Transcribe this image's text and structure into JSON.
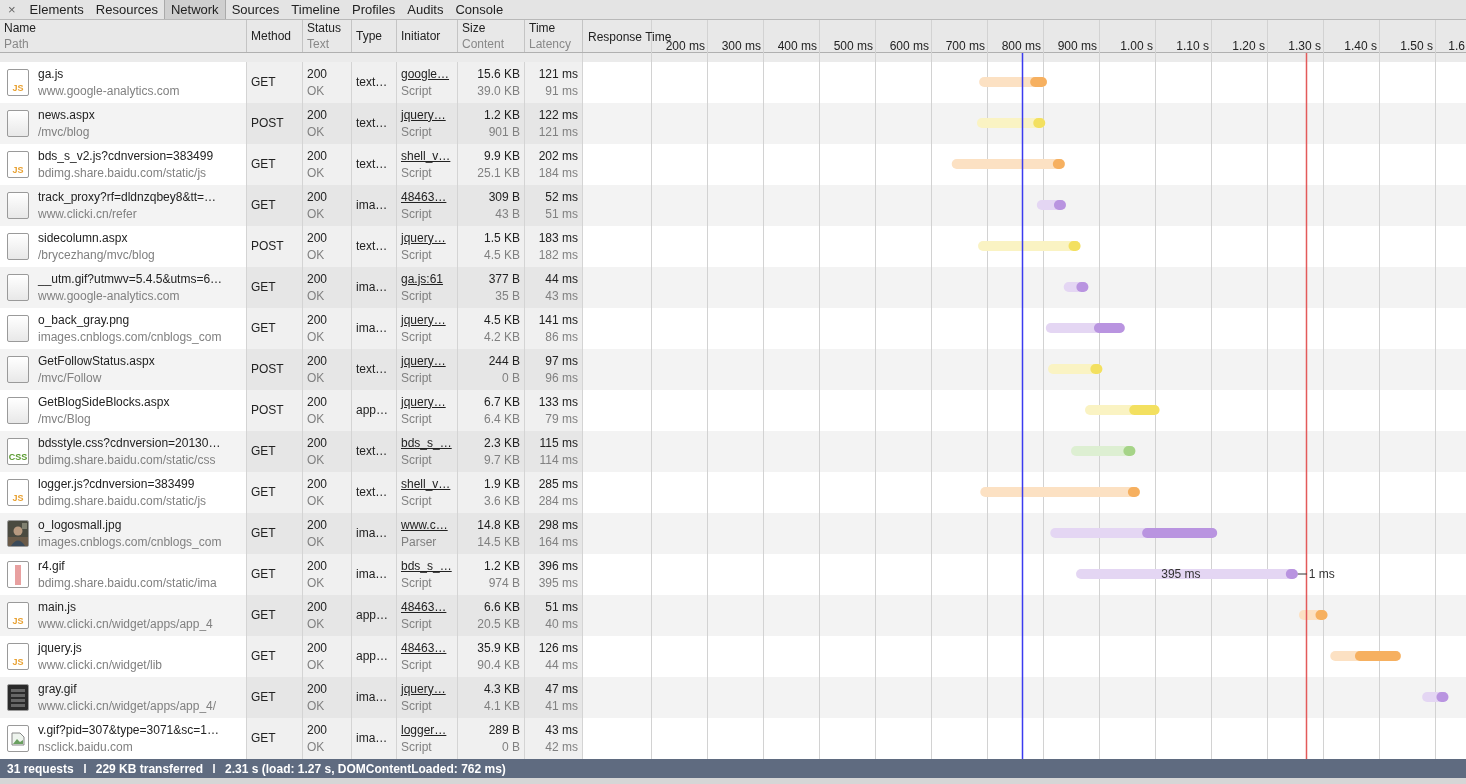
{
  "close_button": "×",
  "tabs": [
    {
      "label": "Elements",
      "selected": false
    },
    {
      "label": "Resources",
      "selected": false
    },
    {
      "label": "Network",
      "selected": true
    },
    {
      "label": "Sources",
      "selected": false
    },
    {
      "label": "Timeline",
      "selected": false
    },
    {
      "label": "Profiles",
      "selected": false
    },
    {
      "label": "Audits",
      "selected": false
    },
    {
      "label": "Console",
      "selected": false
    }
  ],
  "columns": [
    {
      "title": "Name",
      "subtitle": "Path"
    },
    {
      "title": "Method"
    },
    {
      "title": "Status",
      "subtitle": "Text"
    },
    {
      "title": "Type"
    },
    {
      "title": "Initiator"
    },
    {
      "title": "Size",
      "subtitle": "Content"
    },
    {
      "title": "Time",
      "subtitle": "Latency"
    }
  ],
  "timeline_header": "Response Time",
  "requests": [
    {
      "name": "ga.js",
      "path": "www.google-analytics.com",
      "kind": "script",
      "icon_text": "JS",
      "method": "GET",
      "status": "200",
      "status_text": "OK",
      "type": "text…",
      "initiator": "google…",
      "initiator_type": "Script",
      "size": "15.6 KB",
      "content": "39.0 KB",
      "time": "121 ms",
      "latency": "91 ms",
      "color": "#f6b060"
    },
    {
      "name": "news.aspx",
      "path": "/mvc/blog",
      "kind": "blank",
      "method": "POST",
      "status": "200",
      "status_text": "OK",
      "type": "text…",
      "initiator": "jquery…",
      "initiator_type": "Script",
      "size": "1.2 KB",
      "content": "901 B",
      "time": "122 ms",
      "latency": "121 ms",
      "color": "#f3e060"
    },
    {
      "name": "bds_s_v2.js?cdnversion=383499",
      "path": "bdimg.share.baidu.com/static/js",
      "kind": "script",
      "icon_text": "JS",
      "method": "GET",
      "status": "200",
      "status_text": "OK",
      "type": "text…",
      "initiator": "shell_v…",
      "initiator_type": "Script",
      "size": "9.9 KB",
      "content": "25.1 KB",
      "time": "202 ms",
      "latency": "184 ms",
      "color": "#f6b060"
    },
    {
      "name": "track_proxy?rf=dldnzqbey8&tt=…",
      "path": "www.clicki.cn/refer",
      "kind": "blank",
      "method": "GET",
      "status": "200",
      "status_text": "OK",
      "type": "ima…",
      "initiator": "48463…",
      "initiator_type": "Script",
      "size": "309 B",
      "content": "43 B",
      "time": "52 ms",
      "latency": "51 ms",
      "color": "#b994e0"
    },
    {
      "name": "sidecolumn.aspx",
      "path": "/brycezhang/mvc/blog",
      "kind": "blank",
      "method": "POST",
      "status": "200",
      "status_text": "OK",
      "type": "text…",
      "initiator": "jquery…",
      "initiator_type": "Script",
      "size": "1.5 KB",
      "content": "4.5 KB",
      "time": "183 ms",
      "latency": "182 ms",
      "color": "#f3e060"
    },
    {
      "name": "__utm.gif?utmwv=5.4.5&utms=6…",
      "path": "www.google-analytics.com",
      "kind": "blank",
      "method": "GET",
      "status": "200",
      "status_text": "OK",
      "type": "ima…",
      "initiator": "ga.js:61",
      "initiator_type": "Script",
      "size": "377 B",
      "content": "35 B",
      "time": "44 ms",
      "latency": "43 ms",
      "color": "#b994e0"
    },
    {
      "name": "o_back_gray.png",
      "path": "images.cnblogs.com/cnblogs_com",
      "kind": "blank",
      "method": "GET",
      "status": "200",
      "status_text": "OK",
      "type": "ima…",
      "initiator": "jquery…",
      "initiator_type": "Script",
      "size": "4.5 KB",
      "content": "4.2 KB",
      "time": "141 ms",
      "latency": "86 ms",
      "color": "#b994e0"
    },
    {
      "name": "GetFollowStatus.aspx",
      "path": "/mvc/Follow",
      "kind": "blank",
      "method": "POST",
      "status": "200",
      "status_text": "OK",
      "type": "text…",
      "initiator": "jquery…",
      "initiator_type": "Script",
      "size": "244 B",
      "content": "0 B",
      "time": "97 ms",
      "latency": "96 ms",
      "color": "#f3e060"
    },
    {
      "name": "GetBlogSideBlocks.aspx",
      "path": "/mvc/Blog",
      "kind": "blank",
      "method": "POST",
      "status": "200",
      "status_text": "OK",
      "type": "app…",
      "initiator": "jquery…",
      "initiator_type": "Script",
      "size": "6.7 KB",
      "content": "6.4 KB",
      "time": "133 ms",
      "latency": "79 ms",
      "color": "#f3e060"
    },
    {
      "name": "bdsstyle.css?cdnversion=20130…",
      "path": "bdimg.share.baidu.com/static/css",
      "kind": "stylesheet",
      "icon_text": "CSS",
      "method": "GET",
      "status": "200",
      "status_text": "OK",
      "type": "text…",
      "initiator": "bds_s_…",
      "initiator_type": "Script",
      "size": "2.3 KB",
      "content": "9.7 KB",
      "time": "115 ms",
      "latency": "114 ms",
      "color": "#a6d488"
    },
    {
      "name": "logger.js?cdnversion=383499",
      "path": "bdimg.share.baidu.com/static/js",
      "kind": "script",
      "icon_text": "JS",
      "method": "GET",
      "status": "200",
      "status_text": "OK",
      "type": "text…",
      "initiator": "shell_v…",
      "initiator_type": "Script",
      "size": "1.9 KB",
      "content": "3.6 KB",
      "time": "285 ms",
      "latency": "284 ms",
      "color": "#f6b060"
    },
    {
      "name": "o_logosmall.jpg",
      "path": "images.cnblogs.com/cnblogs_com",
      "method": "GET",
      "status": "200",
      "status_text": "OK",
      "type": "ima…",
      "initiator": "www.c…",
      "initiator_type": "Parser",
      "size": "14.8 KB",
      "content": "14.5 KB",
      "time": "298 ms",
      "latency": "164 ms",
      "color": "#b994e0"
    },
    {
      "name": "r4.gif",
      "path": "bdimg.share.baidu.com/static/ima",
      "kind": "strip",
      "method": "GET",
      "status": "200",
      "status_text": "OK",
      "type": "ima…",
      "initiator": "bds_s_…",
      "initiator_type": "Script",
      "size": "1.2 KB",
      "content": "974 B",
      "time": "396 ms",
      "latency": "395 ms",
      "color": "#b994e0"
    },
    {
      "name": "main.js",
      "path": "www.clicki.cn/widget/apps/app_4",
      "kind": "script",
      "icon_text": "JS",
      "method": "GET",
      "status": "200",
      "status_text": "OK",
      "type": "app…",
      "initiator": "48463…",
      "initiator_type": "Script",
      "size": "6.6 KB",
      "content": "20.5 KB",
      "time": "51 ms",
      "latency": "40 ms",
      "color": "#f6b060"
    },
    {
      "name": "jquery.js",
      "path": "www.clicki.cn/widget/lib",
      "kind": "script",
      "icon_text": "JS",
      "method": "GET",
      "status": "200",
      "status_text": "OK",
      "type": "app…",
      "initiator": "48463…",
      "initiator_type": "Script",
      "size": "35.9 KB",
      "content": "90.4 KB",
      "time": "126 ms",
      "latency": "44 ms",
      "color": "#f6b060"
    },
    {
      "name": "gray.gif",
      "path": "www.clicki.cn/widget/apps/app_4/",
      "kind": "dark",
      "method": "GET",
      "status": "200",
      "status_text": "OK",
      "type": "ima…",
      "initiator": "jquery…",
      "initiator_type": "Script",
      "size": "4.3 KB",
      "content": "4.1 KB",
      "time": "47 ms",
      "latency": "41 ms",
      "color": "#b994e0"
    },
    {
      "name": "v.gif?pid=307&type=3071&sc=1…",
      "path": "nsclick.baidu.com",
      "kind": "broken",
      "method": "GET",
      "status": "200",
      "status_text": "OK",
      "type": "ima…",
      "initiator": "logger…",
      "initiator_type": "Script",
      "size": "289 B",
      "content": "0 B",
      "time": "43 ms",
      "latency": "42 ms"
    }
  ],
  "timeline": {
    "tick_labels": [
      "200 ms",
      "300 ms",
      "400 ms",
      "500 ms",
      "600 ms",
      "700 ms",
      "800 ms",
      "900 ms",
      "1.00 s",
      "1.10 s",
      "1.20 s",
      "1.30 s",
      "1.40 s",
      "1.50 s",
      "1.6"
    ],
    "latency_label": "395 ms",
    "receiving_label": "1 ms"
  },
  "status_bar": [
    "31 requests",
    "229 KB transferred",
    "2.31 s (load: 1.27 s, DOMContentLoaded: 762 ms)"
  ]
}
